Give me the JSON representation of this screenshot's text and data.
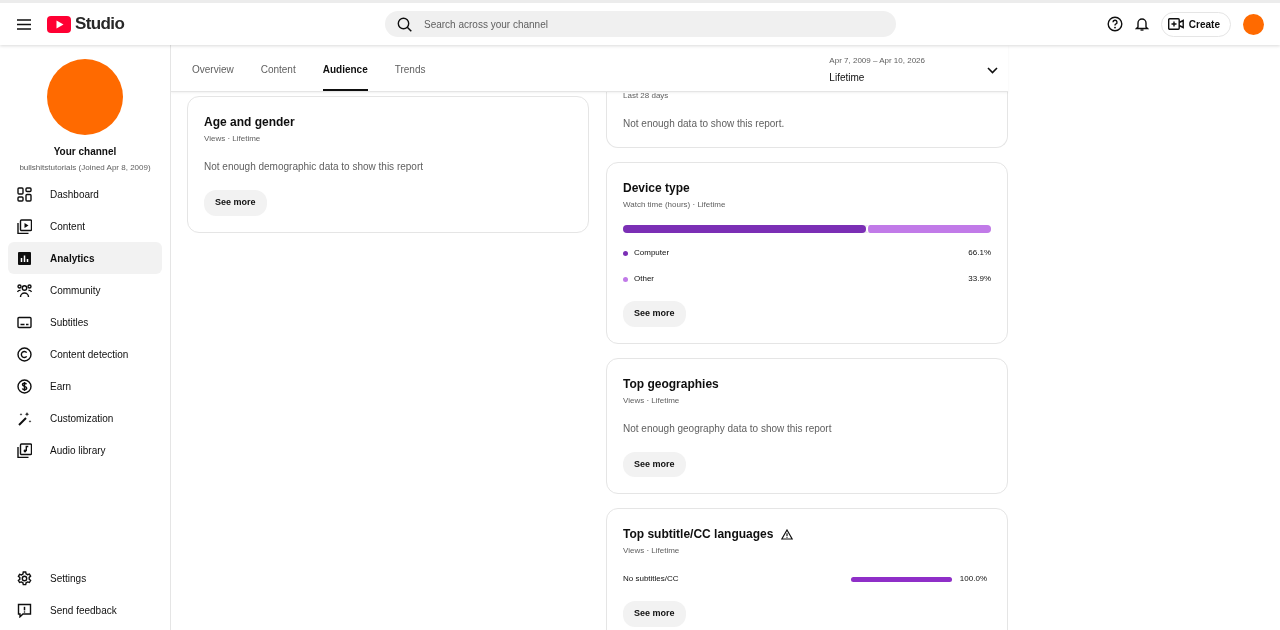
{
  "header": {
    "logo_text": "Studio",
    "search": {
      "placeholder": "Search across your channel"
    },
    "create_button": "Create"
  },
  "sidebar": {
    "channel_title": "Your channel",
    "channel_subtitle": "bullshitstutorials (Joined Apr 8, 2009)",
    "items": [
      {
        "label": "Dashboard",
        "selected": false
      },
      {
        "label": "Content",
        "selected": false
      },
      {
        "label": "Analytics",
        "selected": true
      },
      {
        "label": "Community",
        "selected": false
      },
      {
        "label": "Subtitles",
        "selected": false
      },
      {
        "label": "Content detection",
        "selected": false
      },
      {
        "label": "Earn",
        "selected": false
      },
      {
        "label": "Customization",
        "selected": false
      },
      {
        "label": "Audio library",
        "selected": false
      }
    ],
    "footer_items": [
      {
        "label": "Settings"
      },
      {
        "label": "Send feedback"
      }
    ]
  },
  "tabs": [
    {
      "label": "Overview",
      "selected": false
    },
    {
      "label": "Content",
      "selected": false
    },
    {
      "label": "Audience",
      "selected": true
    },
    {
      "label": "Trends",
      "selected": false
    }
  ],
  "date_range": {
    "range": "Apr 7, 2009 – Apr 10, 2026",
    "label": "Lifetime"
  },
  "left_cards": [
    {
      "kind": "message",
      "title": "Age and gender",
      "subtitle": "Views · Lifetime",
      "message": "Not enough demographic data to show this report",
      "button": "See more"
    }
  ],
  "right_cards": [
    {
      "kind": "message",
      "subtitle": "Last 28 days",
      "message": "Not enough data to show this report."
    },
    {
      "kind": "segments",
      "title": "Device type",
      "subtitle": "Watch time (hours) · Lifetime",
      "segments": [
        {
          "label": "Computer",
          "value": "66.1%",
          "level": 0.661,
          "color": "#7b2fb5"
        },
        {
          "label": "Other",
          "value": "33.9%",
          "level": 0.339,
          "color": "#c17ae8"
        }
      ],
      "button": "See more"
    },
    {
      "kind": "message",
      "title": "Top geographies",
      "subtitle": "Views · Lifetime",
      "message": "Not enough geography data to show this report",
      "button": "See more"
    },
    {
      "kind": "bars",
      "title": "Top subtitle/CC languages",
      "warning": true,
      "subtitle": "Views · Lifetime",
      "rows": [
        {
          "label": "No subtitles/CC",
          "value": "100.0%",
          "level": 1.0
        }
      ],
      "button": "See more"
    }
  ]
}
